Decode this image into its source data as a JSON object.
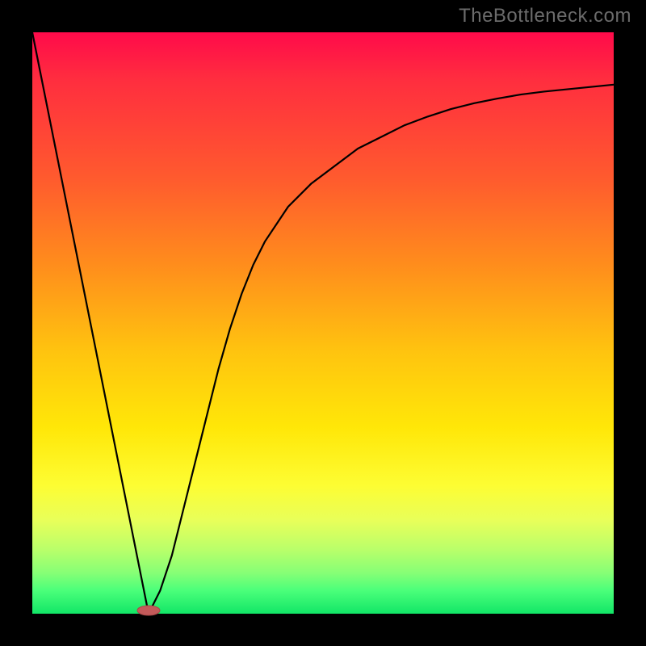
{
  "attribution": "TheBottleneck.com",
  "colors": {
    "gradient_stops": [
      "#ff0a4a",
      "#ff2d3f",
      "#ff5a2e",
      "#ff8d1c",
      "#ffc40f",
      "#ffe708",
      "#fdfd33",
      "#e8ff5a",
      "#b9ff6a",
      "#86ff76",
      "#4bff7a",
      "#12e667"
    ],
    "curve": "#000000",
    "marker": "#c35a5a",
    "frame": "#000000"
  },
  "chart_data": {
    "type": "line",
    "title": "",
    "xlabel": "",
    "ylabel": "",
    "xlim": [
      0,
      100
    ],
    "ylim": [
      0,
      100
    ],
    "grid": false,
    "legend": false,
    "series": [
      {
        "name": "bottleneck-curve",
        "x": [
          0,
          2,
          4,
          6,
          8,
          10,
          12,
          14,
          16,
          18,
          20,
          22,
          24,
          26,
          28,
          30,
          32,
          34,
          36,
          38,
          40,
          44,
          48,
          52,
          56,
          60,
          64,
          68,
          72,
          76,
          80,
          84,
          88,
          92,
          96,
          100
        ],
        "y": [
          100,
          90,
          80,
          70,
          60,
          50,
          40,
          30,
          20,
          10,
          0,
          4,
          10,
          18,
          26,
          34,
          42,
          49,
          55,
          60,
          64,
          70,
          74,
          77,
          80,
          82,
          84,
          85.5,
          86.8,
          87.8,
          88.6,
          89.3,
          89.8,
          90.2,
          90.6,
          91
        ]
      }
    ],
    "annotations": [
      {
        "name": "optimal-point",
        "x": 20,
        "y": 0,
        "shape": "lozenge"
      }
    ]
  }
}
